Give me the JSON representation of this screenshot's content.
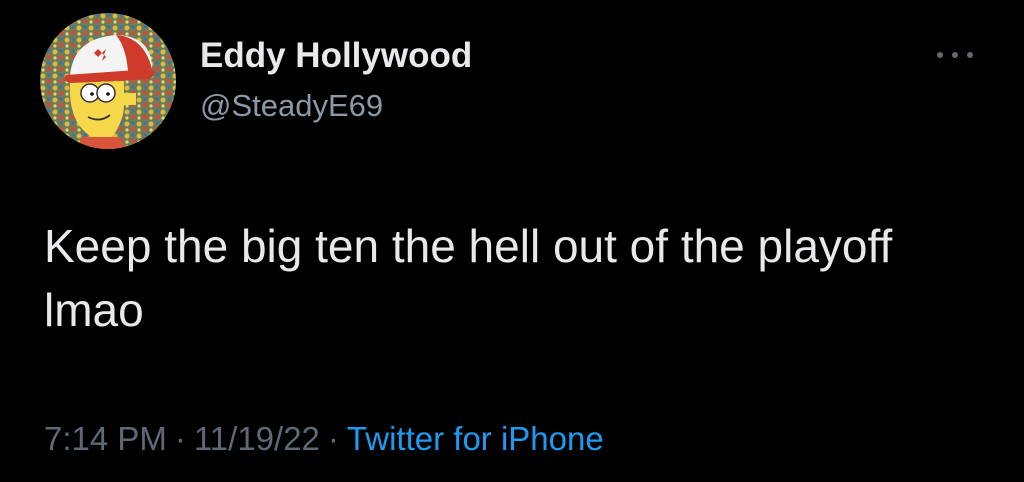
{
  "tweet": {
    "display_name": "Eddy Hollywood",
    "handle": "@SteadyE69",
    "text": "Keep the big ten the hell out of the playoff lmao",
    "time": "7:14 PM",
    "separator": "·",
    "date": "11/19/22",
    "source": "Twitter for iPhone",
    "avatar_icon": "cartoon-avatar-icon",
    "more_icon": "more-options-icon"
  },
  "colors": {
    "background": "#000000",
    "text": "#e7e9ea",
    "secondary": "#8b98a5",
    "accent": "#1d9bf0"
  }
}
